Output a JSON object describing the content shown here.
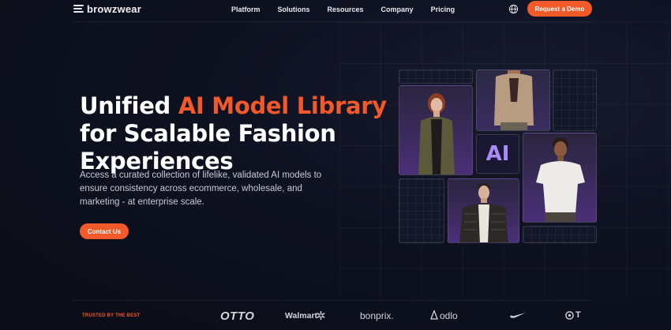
{
  "nav": {
    "logo": "browzwear",
    "links": [
      "Platform",
      "Solutions",
      "Resources",
      "Company",
      "Pricing"
    ],
    "cta": "Request a Demo",
    "globe_icon": "globe-icon"
  },
  "hero": {
    "title_line1_prefix": "Unified ",
    "title_line1_accent": "AI Model Library",
    "title_line2": "for Scalable Fashion",
    "title_line3": "Experiences",
    "subtitle": "Access a curated collection of lifelike, validated AI models to ensure consistency across ecommerce, wholesale, and marketing - at enterprise scale.",
    "cta": "Contact Us",
    "ai_badge": "AI"
  },
  "trusted": {
    "label": "TRUSTED BY THE BEST",
    "brands": [
      "OTTO",
      "Walmart",
      "bonprix.",
      "odlo",
      "nike-logo",
      "T"
    ]
  },
  "colors": {
    "accent": "#f25a29",
    "background": "#0b0d18",
    "ai_purple": "#a88bf7"
  }
}
